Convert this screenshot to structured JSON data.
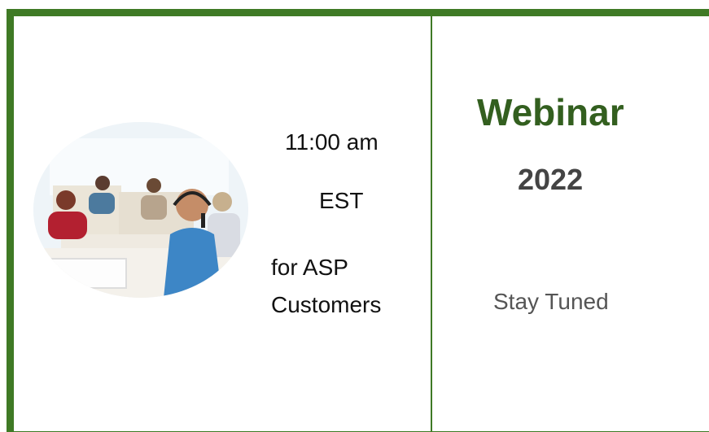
{
  "left_panel": {
    "time": "11:00 am",
    "timezone": "EST",
    "audience_line1": "for ASP",
    "audience_line2": "Customers"
  },
  "right_panel": {
    "title": "Webinar",
    "year": "2022",
    "note": "Stay Tuned"
  },
  "colors": {
    "frame_green": "#3f7a25",
    "title_green": "#335f1f",
    "year_gray": "#444444",
    "note_gray": "#555555"
  }
}
